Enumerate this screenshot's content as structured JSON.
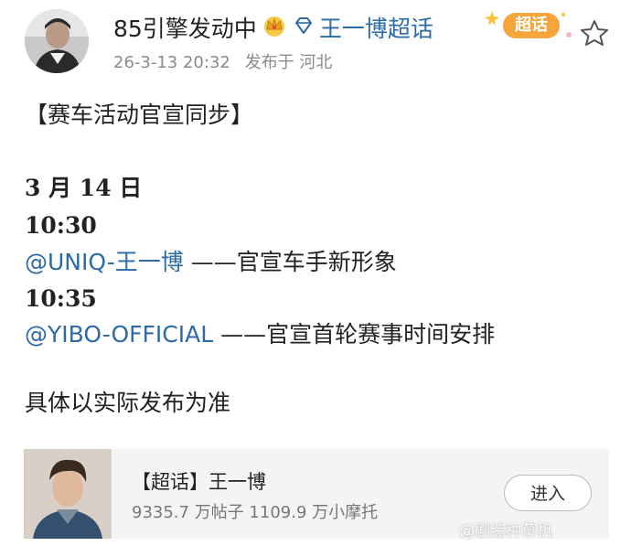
{
  "header": {
    "user_name": "85引擎发动中",
    "supertopic_link": "王一博超话",
    "timestamp": "26-3-13 20:32",
    "location": "发布于 河北",
    "badge_label": "超话",
    "icons": {
      "crown": "crown-icon",
      "diamond": "diamond-icon",
      "star": "star-icon"
    }
  },
  "post": {
    "title": "【赛车活动官宣同步】",
    "date": "3 月 14 日",
    "items": [
      {
        "time": "10:30",
        "mention": "@UNIQ-王一博",
        "text": " ——官宣车手新形象"
      },
      {
        "time": "10:35",
        "mention": "@YIBO-OFFICIAL",
        "text": " ——官宣首轮赛事时间安排"
      }
    ],
    "footer": "具体以实际发布为准"
  },
  "card": {
    "title": "【超话】王一博",
    "stats": "9335.7 万帖子 1109.9 万小摩托",
    "button_label": "进入"
  },
  "watermark": "@剧综种草机",
  "colors": {
    "link": "#2d6aa8",
    "badge": "#f5a53a",
    "card_bg": "#f4f4f4"
  }
}
